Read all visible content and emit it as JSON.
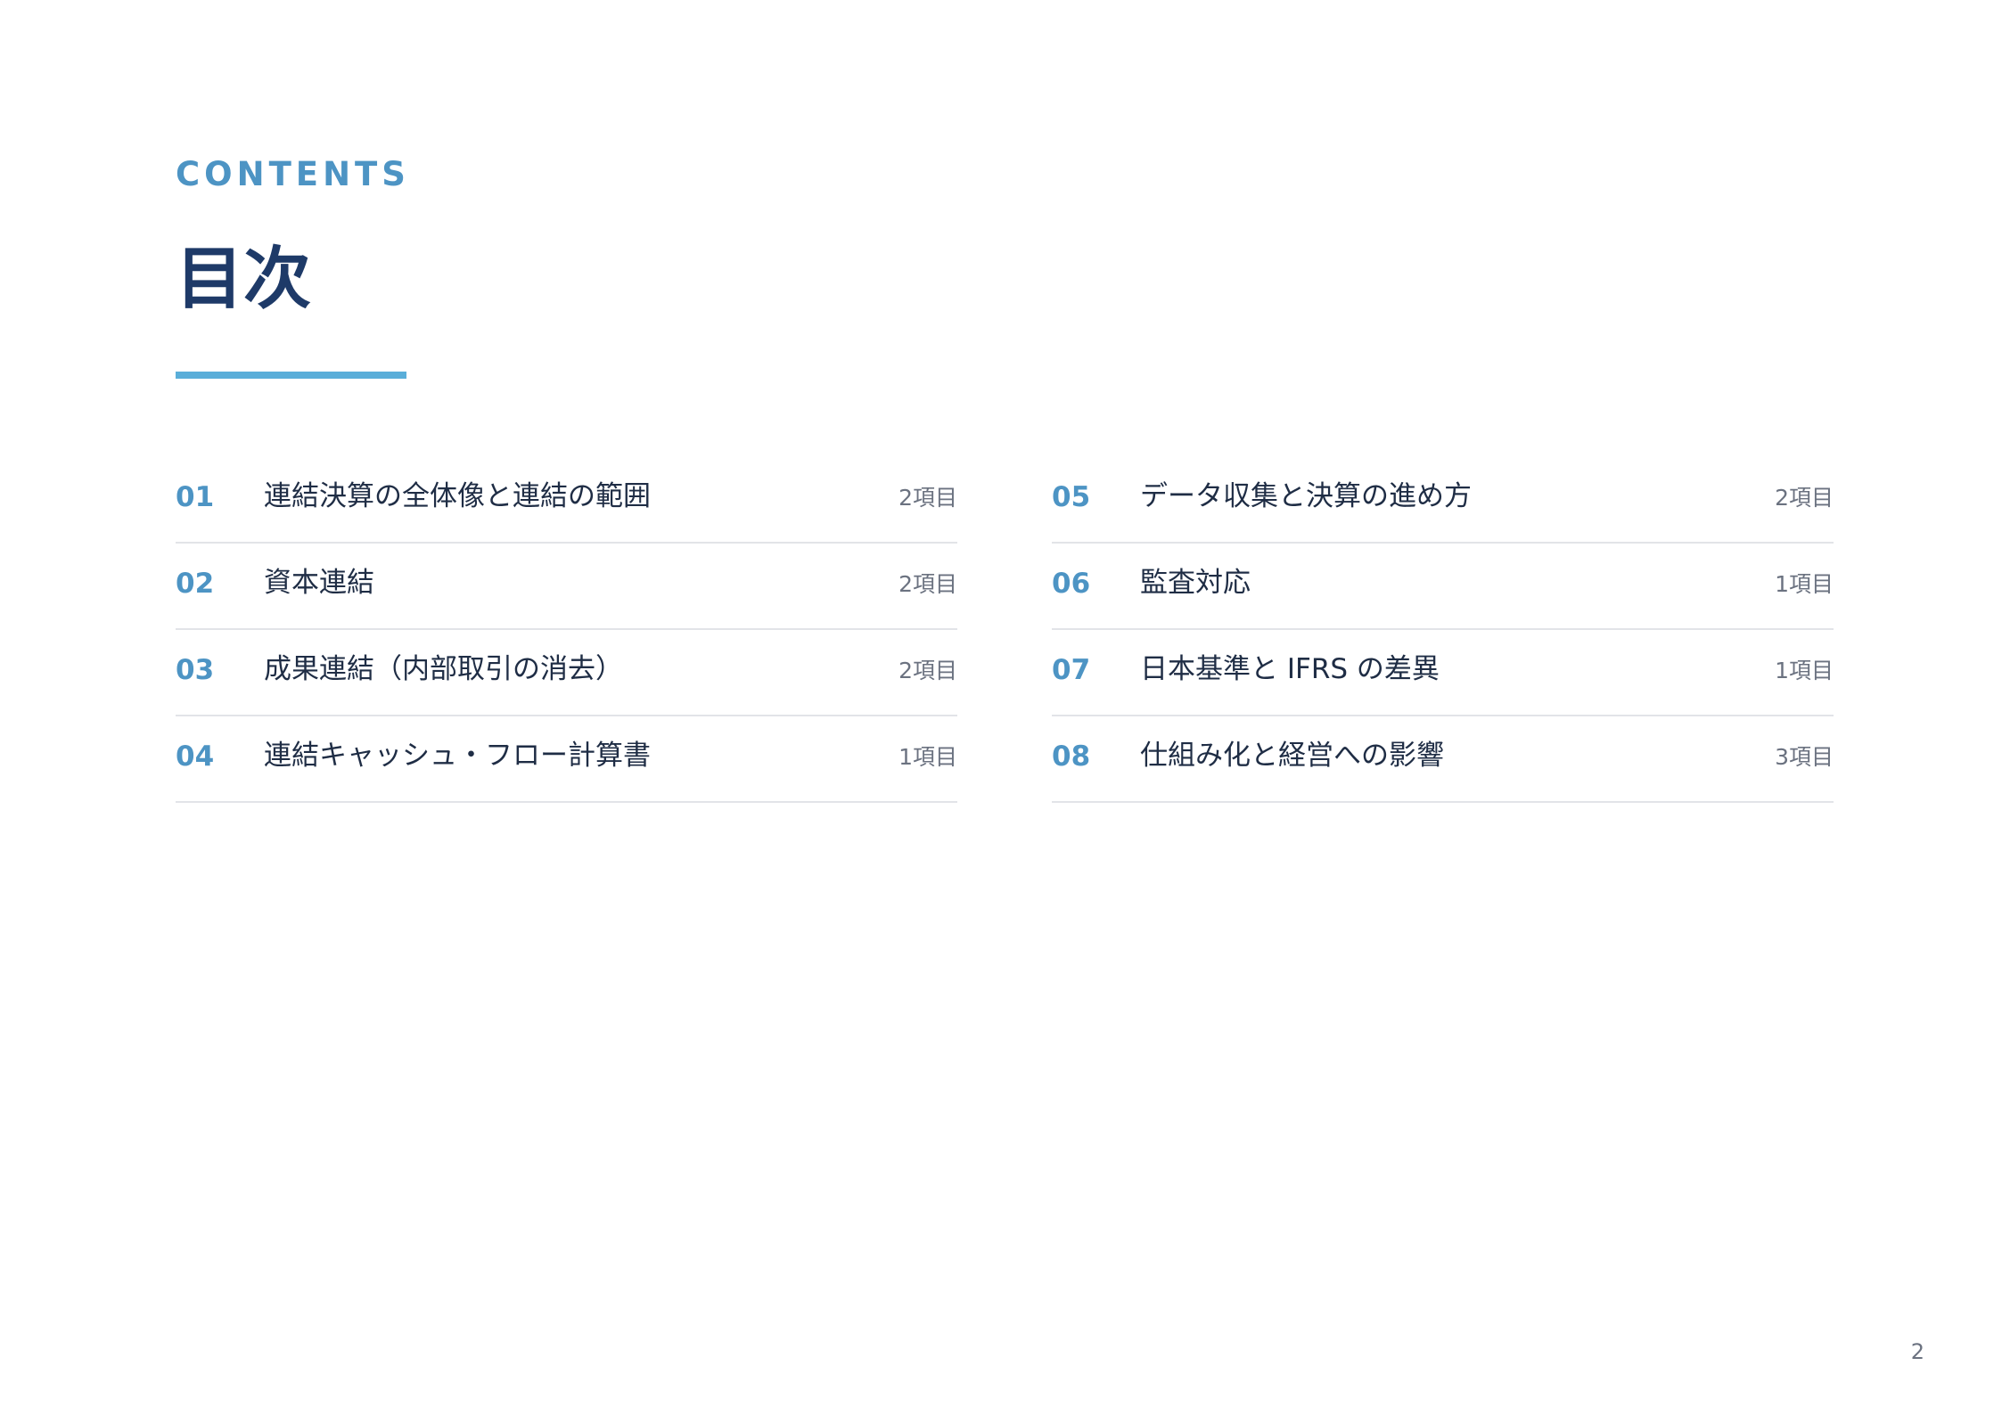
{
  "header": {
    "eyebrow": "CONTENTS",
    "title": "目次"
  },
  "toc": {
    "left": [
      {
        "number": "01",
        "title": "連結決算の全体像と連結の範囲",
        "count": "2項目"
      },
      {
        "number": "02",
        "title": "資本連結",
        "count": "2項目"
      },
      {
        "number": "03",
        "title": "成果連結（内部取引の消去）",
        "count": "2項目"
      },
      {
        "number": "04",
        "title": "連結キャッシュ・フロー計算書",
        "count": "1項目"
      }
    ],
    "right": [
      {
        "number": "05",
        "title": "データ収集と決算の進め方",
        "count": "2項目"
      },
      {
        "number": "06",
        "title": "監査対応",
        "count": "1項目"
      },
      {
        "number": "07",
        "title": "日本基準と IFRS の差異",
        "count": "1項目"
      },
      {
        "number": "08",
        "title": "仕組み化と経営への影響",
        "count": "3項目"
      }
    ]
  },
  "footer": {
    "page_number": "2"
  },
  "colors": {
    "accent": "#4d94c4",
    "title": "#1e3a68",
    "rule": "#5aaed9",
    "text": "#1f2d45",
    "muted": "#6b7280",
    "divider": "#e2e4e8"
  }
}
